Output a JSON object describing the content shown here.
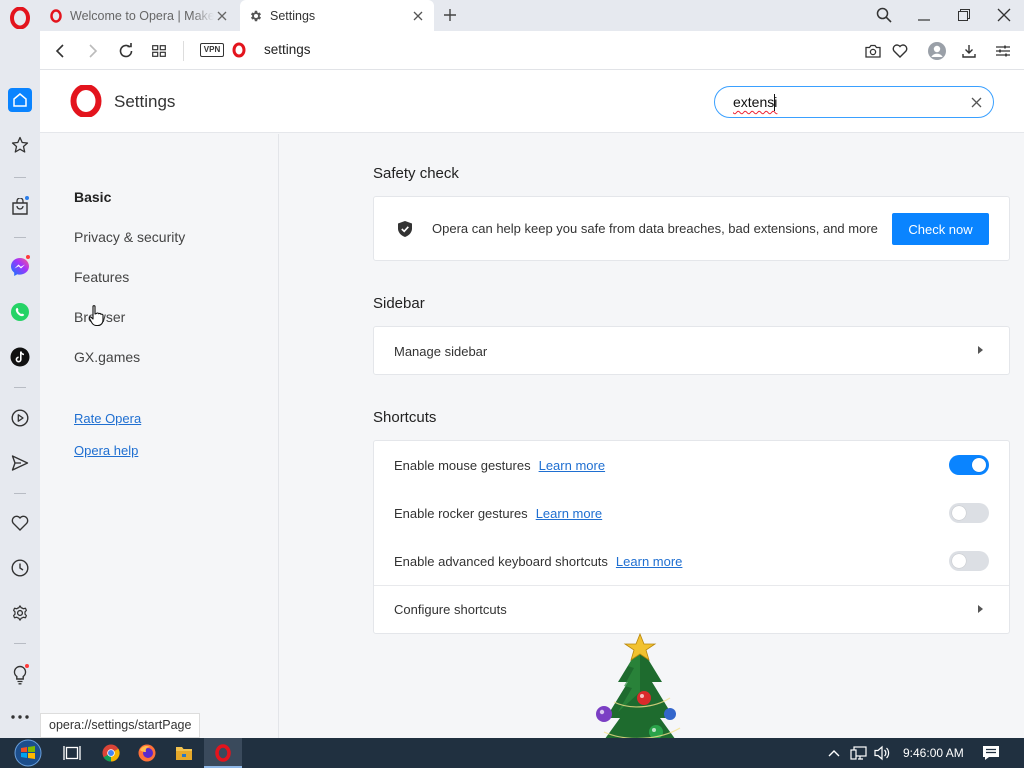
{
  "tabs": [
    {
      "label": "Welcome to Opera | Make"
    },
    {
      "label": "Settings"
    }
  ],
  "address": {
    "vpn_badge": "VPN",
    "url": "settings"
  },
  "settings_header": {
    "title": "Settings",
    "search_value": "extensi"
  },
  "nav": {
    "items": [
      {
        "label": "Basic"
      },
      {
        "label": "Privacy & security"
      },
      {
        "label": "Features"
      },
      {
        "label": "Browser"
      },
      {
        "label": "GX.games"
      }
    ],
    "links": [
      {
        "label": "Rate Opera"
      },
      {
        "label": "Opera help"
      }
    ]
  },
  "sections": {
    "safety": {
      "title": "Safety check",
      "text": "Opera can help keep you safe from data breaches, bad extensions, and more",
      "button": "Check now"
    },
    "sidebar": {
      "title": "Sidebar",
      "row": "Manage sidebar"
    },
    "shortcuts": {
      "title": "Shortcuts",
      "rows": [
        {
          "label": "Enable mouse gestures",
          "link": "Learn more",
          "enabled": true
        },
        {
          "label": "Enable rocker gestures",
          "link": "Learn more",
          "enabled": false
        },
        {
          "label": "Enable advanced keyboard shortcuts",
          "link": "Learn more",
          "enabled": false
        }
      ],
      "configure": "Configure shortcuts"
    }
  },
  "status_url": "opera://settings/startPage",
  "taskbar": {
    "clock": "9:46:00 AM"
  },
  "colors": {
    "accent": "#0a84ff",
    "opera_red": "#e3141d"
  }
}
